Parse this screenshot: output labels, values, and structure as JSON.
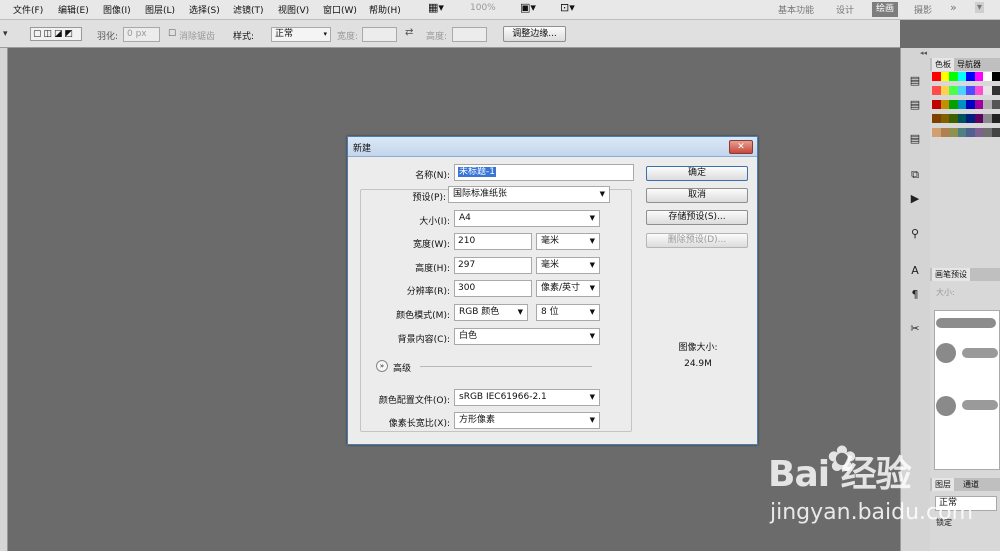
{
  "menu": [
    "文件(F)",
    "编辑(E)",
    "图像(I)",
    "图层(L)",
    "选择(S)",
    "滤镜(T)",
    "视图(V)",
    "窗口(W)",
    "帮助(H)"
  ],
  "zoom": "100%",
  "workspaces": [
    "基本功能",
    "设计",
    "绘画",
    "摄影"
  ],
  "workspace_more": "»",
  "options": {
    "feather_label": "羽化:",
    "feather_value": "0 px",
    "antialias_label": "消除锯齿",
    "style_label": "样式:",
    "style_value": "正常",
    "width_label": "宽度:",
    "height_label": "高度:",
    "refine_button": "调整边缘..."
  },
  "right_panels": {
    "swatch_tabs": [
      "色板",
      "导航器"
    ],
    "brush_tab": "画笔预设",
    "brush_size_label": "大小:",
    "layers_tabs": [
      "图层",
      "通道"
    ],
    "blend_mode": "正常",
    "lock_label": "锁定"
  },
  "dialog": {
    "title": "新建",
    "name_label": "名称(N):",
    "name_value": "未标题-1",
    "preset_label": "预设(P):",
    "preset_value": "国际标准纸张",
    "size_label": "大小(I):",
    "size_value": "A4",
    "width_label": "宽度(W):",
    "width_value": "210",
    "width_unit": "毫米",
    "height_label": "高度(H):",
    "height_value": "297",
    "height_unit": "毫米",
    "resolution_label": "分辨率(R):",
    "resolution_value": "300",
    "resolution_unit": "像素/英寸",
    "color_mode_label": "颜色模式(M):",
    "color_mode_value": "RGB 颜色",
    "bit_depth": "8 位",
    "background_label": "背景内容(C):",
    "background_value": "白色",
    "advanced_label": "高级",
    "color_profile_label": "颜色配置文件(O):",
    "color_profile_value": "sRGB IEC61966-2.1",
    "pixel_aspect_label": "像素长宽比(X):",
    "pixel_aspect_value": "方形像素",
    "ok_button": "确定",
    "cancel_button": "取消",
    "save_preset_button": "存储预设(S)...",
    "delete_preset_button": "删除预设(D)...",
    "image_size_label": "图像大小:",
    "image_size_value": "24.9M"
  },
  "watermark": {
    "logo_text": "Bai  经验",
    "url": "jingyan.baidu.com"
  },
  "swatch_colors": [
    "#ff0000",
    "#ffff00",
    "#00ff00",
    "#00ffff",
    "#0000ff",
    "#ff00ff",
    "#ffffff",
    "#000000",
    "#ff4d4d",
    "#ffd24d",
    "#4dff4d",
    "#4dd2ff",
    "#4d4dff",
    "#ff4dd2",
    "#e6e6e6",
    "#333333",
    "#c00000",
    "#c09000",
    "#00a000",
    "#0090c0",
    "#0000c0",
    "#a000a0",
    "#b0b0b0",
    "#555555",
    "#804000",
    "#806000",
    "#406000",
    "#005060",
    "#002080",
    "#600060",
    "#8a8a8a",
    "#222222",
    "#d0a070",
    "#b08050",
    "#909050",
    "#508080",
    "#506090",
    "#806090",
    "#707070",
    "#444444"
  ]
}
